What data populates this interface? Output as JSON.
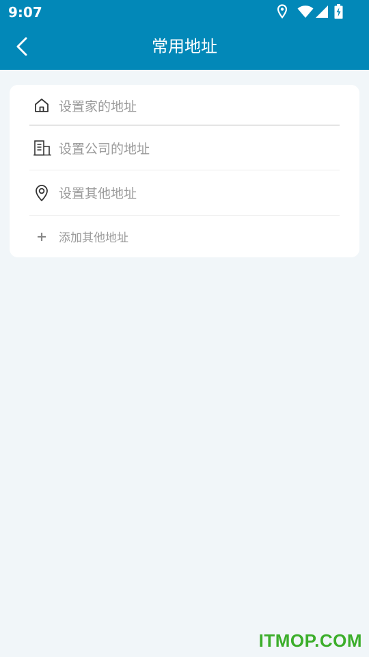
{
  "status_bar": {
    "time": "9:07",
    "icons": [
      "location-icon",
      "wifi-icon",
      "signal-icon",
      "battery-charging-icon"
    ]
  },
  "app_bar": {
    "back_icon": "chevron-left-icon",
    "title": "常用地址"
  },
  "addresses": [
    {
      "icon": "home-icon",
      "label": "设置家的地址"
    },
    {
      "icon": "building-icon",
      "label": "设置公司的地址"
    },
    {
      "icon": "location-pin-icon",
      "label": "设置其他地址"
    },
    {
      "icon": "plus-icon",
      "label": "添加其他地址"
    }
  ],
  "watermark": "ITMOP.COM",
  "colors": {
    "primary": "#0288b8",
    "background": "#f1f6f9",
    "card": "#ffffff",
    "label_text": "#9a9a9a",
    "icon": "#333333",
    "watermark": "#3cae2b"
  }
}
